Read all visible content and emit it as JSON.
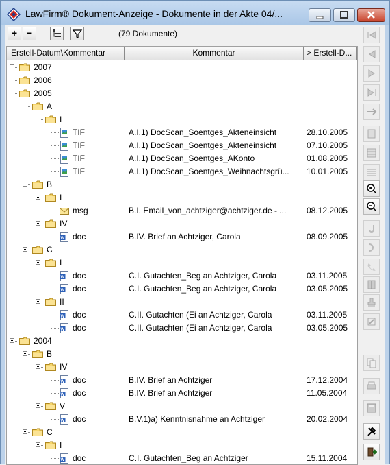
{
  "window": {
    "title": "LawFirm® Dokument-Anzeige - Dokumente in der Akte 04/...",
    "buttons": {
      "minimize": "minimize",
      "maximize": "maximize",
      "close": "close"
    }
  },
  "toolbar": {
    "expand_label": "+",
    "collapse_label": "−",
    "doc_count": "(79 Dokumente)"
  },
  "grid": {
    "headers": {
      "col1": "Erstell-Datum\\Kommentar",
      "col2": "Kommentar",
      "col3": "> Erstell-D..."
    },
    "rows": [
      {
        "kind": "folder",
        "level": 0,
        "label": "2007",
        "expand": "plus"
      },
      {
        "kind": "folder",
        "level": 0,
        "label": "2006",
        "expand": "plus"
      },
      {
        "kind": "folder",
        "level": 0,
        "label": "2005",
        "expand": "minus"
      },
      {
        "kind": "folder",
        "level": 1,
        "label": "A",
        "expand": "minus"
      },
      {
        "kind": "folder",
        "level": 2,
        "label": "I",
        "expand": "minus"
      },
      {
        "kind": "doc",
        "level": 3,
        "icon": "image",
        "type": "TIF",
        "comment": "A.I.1) DocScan_Soentges_Akteneinsicht",
        "date": "28.10.2005"
      },
      {
        "kind": "doc",
        "level": 3,
        "icon": "image",
        "type": "TIF",
        "comment": "A.I.1) DocScan_Soentges_Akteneinsicht",
        "date": "07.10.2005"
      },
      {
        "kind": "doc",
        "level": 3,
        "icon": "image",
        "type": "TIF",
        "comment": "A.I.1) DocScan_Soentges_AKonto",
        "date": "01.08.2005"
      },
      {
        "kind": "doc",
        "level": 3,
        "icon": "image",
        "type": "TIF",
        "comment": "A.I.1) DocScan_Soentges_Weihnachtsgrü...",
        "date": "10.01.2005"
      },
      {
        "kind": "folder",
        "level": 1,
        "label": "B",
        "expand": "minus"
      },
      {
        "kind": "folder",
        "level": 2,
        "label": "I",
        "expand": "minus"
      },
      {
        "kind": "doc",
        "level": 3,
        "icon": "mail",
        "type": "msg",
        "comment": "B.I. Email_von_achtziger@achtziger.de - ...",
        "date": "08.12.2005"
      },
      {
        "kind": "folder",
        "level": 2,
        "label": "IV",
        "expand": "minus"
      },
      {
        "kind": "doc",
        "level": 3,
        "icon": "word",
        "type": "doc",
        "comment": "B.IV. Brief an Achtziger, Carola",
        "date": "08.09.2005"
      },
      {
        "kind": "folder",
        "level": 1,
        "label": "C",
        "expand": "minus"
      },
      {
        "kind": "folder",
        "level": 2,
        "label": "I",
        "expand": "minus"
      },
      {
        "kind": "doc",
        "level": 3,
        "icon": "word",
        "type": "doc",
        "comment": "C.I. Gutachten_Beg an Achtziger, Carola",
        "date": "03.11.2005"
      },
      {
        "kind": "doc",
        "level": 3,
        "icon": "word",
        "type": "doc",
        "comment": "C.I. Gutachten_Beg an Achtziger, Carola",
        "date": "03.05.2005"
      },
      {
        "kind": "folder",
        "level": 2,
        "label": "II",
        "expand": "minus"
      },
      {
        "kind": "doc",
        "level": 3,
        "icon": "word",
        "type": "doc",
        "comment": "C.II. Gutachten (Ei an Achtziger, Carola",
        "date": "03.11.2005"
      },
      {
        "kind": "doc",
        "level": 3,
        "icon": "word",
        "type": "doc",
        "comment": "C.II. Gutachten (Ei an Achtziger, Carola",
        "date": "03.05.2005"
      },
      {
        "kind": "folder",
        "level": 0,
        "label": "2004",
        "expand": "minus"
      },
      {
        "kind": "folder",
        "level": 1,
        "label": "B",
        "expand": "minus"
      },
      {
        "kind": "folder",
        "level": 2,
        "label": "IV",
        "expand": "minus"
      },
      {
        "kind": "doc",
        "level": 3,
        "icon": "word",
        "type": "doc",
        "comment": "B.IV. Brief an Achtziger",
        "date": "17.12.2004"
      },
      {
        "kind": "doc",
        "level": 3,
        "icon": "word",
        "type": "doc",
        "comment": "B.IV. Brief an Achtziger",
        "date": "11.05.2004"
      },
      {
        "kind": "folder",
        "level": 2,
        "label": "V",
        "expand": "minus"
      },
      {
        "kind": "doc",
        "level": 3,
        "icon": "word",
        "type": "doc",
        "comment": "B.V.1)a) Kenntnisnahme an Achtziger",
        "date": "20.02.2004"
      },
      {
        "kind": "folder",
        "level": 1,
        "label": "C",
        "expand": "minus"
      },
      {
        "kind": "folder",
        "level": 2,
        "label": "I",
        "expand": "minus"
      },
      {
        "kind": "doc",
        "level": 3,
        "icon": "word",
        "type": "doc",
        "comment": "C.I. Gutachten_Beg an Achtziger",
        "date": "15.11.2004"
      }
    ]
  },
  "sidebar": {
    "buttons": [
      {
        "name": "first-record-icon",
        "enabled": false
      },
      {
        "name": "previous-record-icon",
        "enabled": false
      },
      {
        "name": "next-record-icon",
        "enabled": false
      },
      {
        "name": "last-record-icon",
        "enabled": false
      },
      {
        "name": "jump-record-icon",
        "enabled": false
      },
      {
        "name": "page-view-icon",
        "enabled": false
      },
      {
        "name": "page-grid-icon",
        "enabled": false
      },
      {
        "name": "page-lines-icon",
        "enabled": false
      },
      {
        "name": "zoom-in-icon",
        "enabled": true
      },
      {
        "name": "zoom-out-icon",
        "enabled": true
      },
      {
        "name": "rotate-left-icon",
        "enabled": false
      },
      {
        "name": "rotate-right-icon",
        "enabled": false
      },
      {
        "name": "phone-icon",
        "enabled": false
      },
      {
        "name": "split-icon",
        "enabled": false
      },
      {
        "name": "stamp-icon",
        "enabled": false
      },
      {
        "name": "annotate-icon",
        "enabled": false
      },
      {
        "name": "copy-icon",
        "enabled": false
      },
      {
        "name": "print-icon",
        "enabled": false
      },
      {
        "name": "save-icon",
        "enabled": false
      },
      {
        "name": "tools-icon",
        "enabled": true
      },
      {
        "name": "exit-icon",
        "enabled": true
      }
    ]
  }
}
